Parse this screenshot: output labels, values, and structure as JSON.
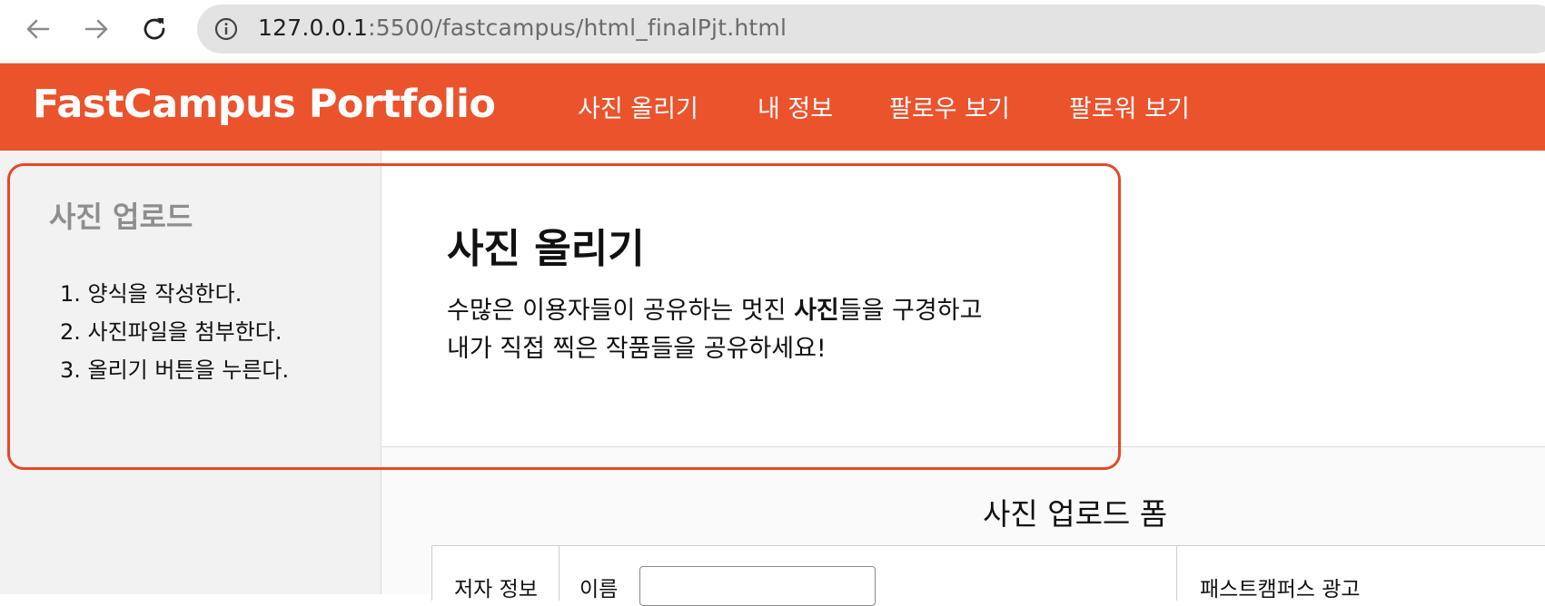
{
  "browser": {
    "url_host": "127.0.0.1",
    "url_rest": ":5500/fastcampus/html_finalPjt.html",
    "icons": [
      "arrow-left-icon",
      "arrow-right-icon",
      "reload-icon",
      "info-icon"
    ]
  },
  "header": {
    "brand": "FastCampus Portfolio",
    "nav": [
      "사진 올리기",
      "내 정보",
      "팔로우 보기",
      "팔로워 보기"
    ],
    "color": "#eb532c"
  },
  "sidebar": {
    "title": "사진 업로드",
    "steps": [
      "1. 양식을 작성한다.",
      "2. 사진파일을 첨부한다.",
      "3. 올리기 버튼을 누른다."
    ]
  },
  "intro": {
    "title": "사진 올리기",
    "line1_before": "수많은 이용자들이 공유하는 멋진 ",
    "line1_bold": "사진",
    "line1_after": "들을 구경하고",
    "line2": "내가 직접 찍은 작품들을 공유하세요!"
  },
  "form": {
    "title": "사진 업로드 폼",
    "author_label": "저자 정보",
    "name_label": "이름",
    "name_value": "",
    "ad_label": "패스트캠퍼스 광고"
  },
  "highlight_color": "#e6482a"
}
